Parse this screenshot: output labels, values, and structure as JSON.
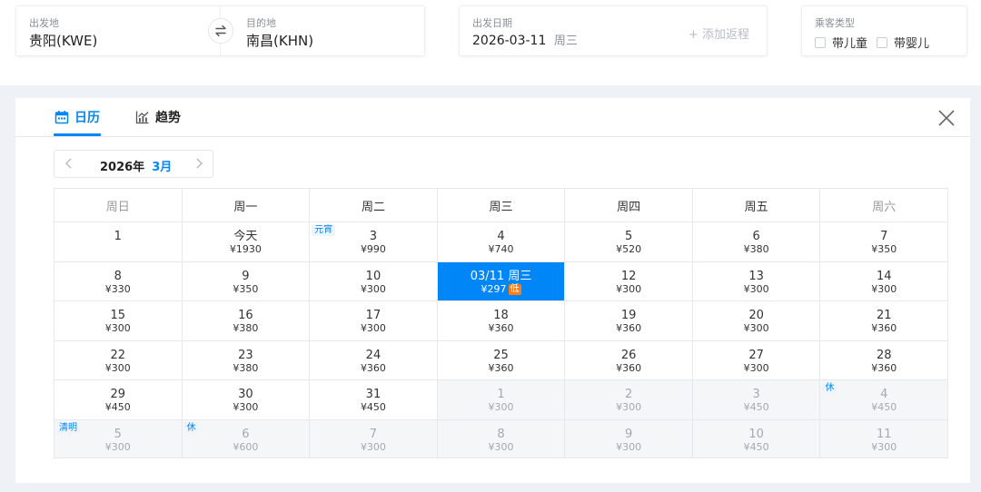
{
  "search": {
    "from_label": "出发地",
    "from_value": "贵阳(KWE)",
    "to_label": "目的地",
    "to_value": "南昌(KHN)",
    "date_label": "出发日期",
    "date_value": "2026-03-11",
    "date_weekday": "周三",
    "add_return": "+ 添加返程",
    "passenger_label": "乘客类型",
    "child_label": "带儿童",
    "infant_label": "带婴儿"
  },
  "tabs": [
    {
      "label": "日历",
      "icon": "calendar-icon",
      "active": true
    },
    {
      "label": "趋势",
      "icon": "trend-chart-icon",
      "active": false
    }
  ],
  "month_nav": {
    "year": "2026年",
    "month": "3月"
  },
  "weekdays": [
    "周日",
    "周一",
    "周二",
    "周三",
    "周四",
    "周五",
    "周六"
  ],
  "colors": {
    "accent": "#0086f6",
    "low_badge": "#ff7d13",
    "other_month_bg": "#f5f6f8"
  },
  "weeks": [
    [
      {
        "day": "1",
        "price": ""
      },
      {
        "day": "今天",
        "price": "¥1930"
      },
      {
        "day": "3",
        "price": "¥990",
        "tag": "元宵"
      },
      {
        "day": "4",
        "price": "¥740"
      },
      {
        "day": "5",
        "price": "¥520"
      },
      {
        "day": "6",
        "price": "¥380"
      },
      {
        "day": "7",
        "price": "¥350"
      }
    ],
    [
      {
        "day": "8",
        "price": "¥330"
      },
      {
        "day": "9",
        "price": "¥350"
      },
      {
        "day": "10",
        "price": "¥300"
      },
      {
        "day": "03/11 周三",
        "price": "¥297",
        "selected": true,
        "low": "低"
      },
      {
        "day": "12",
        "price": "¥300"
      },
      {
        "day": "13",
        "price": "¥300"
      },
      {
        "day": "14",
        "price": "¥300"
      }
    ],
    [
      {
        "day": "15",
        "price": "¥300"
      },
      {
        "day": "16",
        "price": "¥380"
      },
      {
        "day": "17",
        "price": "¥300"
      },
      {
        "day": "18",
        "price": "¥360"
      },
      {
        "day": "19",
        "price": "¥360"
      },
      {
        "day": "20",
        "price": "¥300"
      },
      {
        "day": "21",
        "price": "¥360"
      }
    ],
    [
      {
        "day": "22",
        "price": "¥300"
      },
      {
        "day": "23",
        "price": "¥380"
      },
      {
        "day": "24",
        "price": "¥360"
      },
      {
        "day": "25",
        "price": "¥360"
      },
      {
        "day": "26",
        "price": "¥360"
      },
      {
        "day": "27",
        "price": "¥300"
      },
      {
        "day": "28",
        "price": "¥360"
      }
    ],
    [
      {
        "day": "29",
        "price": "¥450"
      },
      {
        "day": "30",
        "price": "¥300"
      },
      {
        "day": "31",
        "price": "¥450"
      },
      {
        "day": "1",
        "price": "¥300",
        "other": true
      },
      {
        "day": "2",
        "price": "¥300",
        "other": true
      },
      {
        "day": "3",
        "price": "¥450",
        "other": true
      },
      {
        "day": "4",
        "price": "¥450",
        "other": true,
        "tag": "休"
      }
    ],
    [
      {
        "day": "5",
        "price": "¥300",
        "other": true,
        "tag": "清明"
      },
      {
        "day": "6",
        "price": "¥600",
        "other": true,
        "tag": "休"
      },
      {
        "day": "7",
        "price": "¥300",
        "other": true
      },
      {
        "day": "8",
        "price": "¥300",
        "other": true
      },
      {
        "day": "9",
        "price": "¥300",
        "other": true
      },
      {
        "day": "10",
        "price": "¥450",
        "other": true
      },
      {
        "day": "11",
        "price": "¥300",
        "other": true
      }
    ]
  ]
}
